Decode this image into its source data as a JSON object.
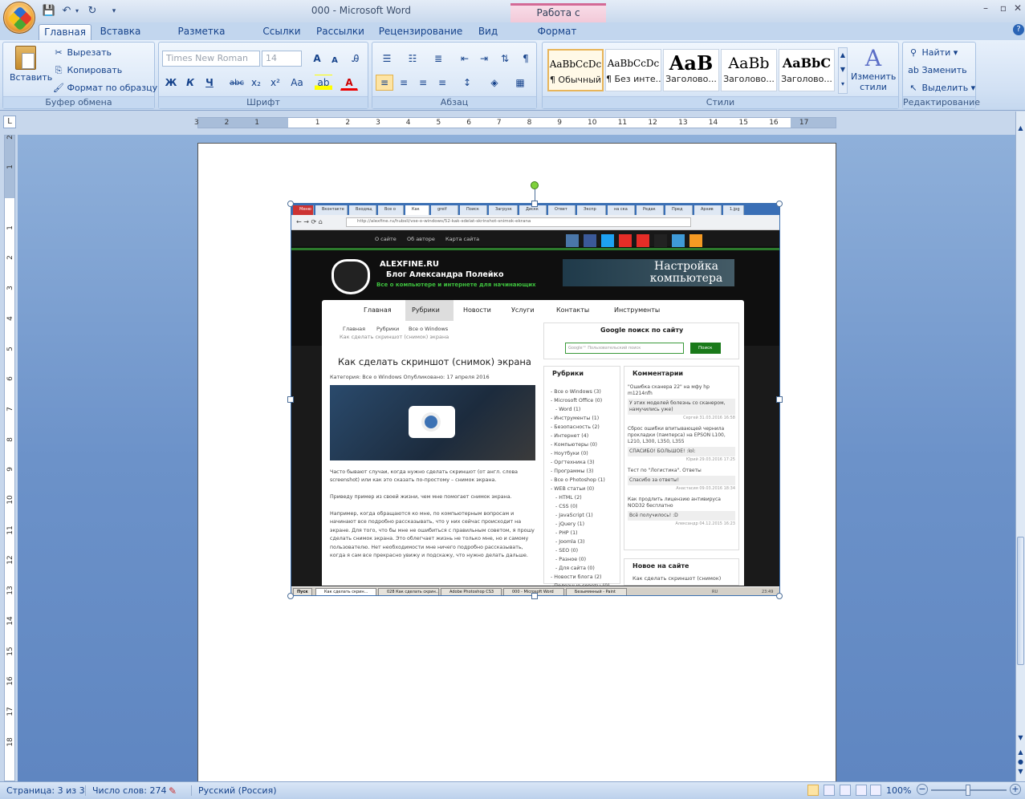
{
  "window": {
    "title": "000 - Microsoft Word",
    "context_tool": "Работа с рисунками"
  },
  "tabs": [
    "Главная",
    "Вставка",
    "Разметка страницы",
    "Ссылки",
    "Рассылки",
    "Рецензирование",
    "Вид",
    "Формат"
  ],
  "ribbon": {
    "clipboard": {
      "paste": "Вставить",
      "cut": "Вырезать",
      "copy": "Копировать",
      "format_painter": "Формат по образцу",
      "label": "Буфер обмена"
    },
    "font": {
      "family": "Times New Roman",
      "size": "14",
      "label": "Шрифт",
      "bold": "Ж",
      "italic": "К",
      "underline": "Ч",
      "strike": "abc",
      "sub": "x₂",
      "sup": "x²",
      "case": "Aa"
    },
    "paragraph": {
      "label": "Абзац"
    },
    "styles": {
      "label": "Стили",
      "items": [
        {
          "sample": "AaBbCcDc",
          "name": "¶ Обычный"
        },
        {
          "sample": "AaBbCcDc",
          "name": "¶ Без инте..."
        },
        {
          "sample": "AaB",
          "name": "Заголово..."
        },
        {
          "sample": "AaBb",
          "name": "Заголово..."
        },
        {
          "sample": "AaBbC",
          "name": "Заголово..."
        }
      ],
      "change": "Изменить стили"
    },
    "editing": {
      "find": "Найти",
      "replace": "Заменить",
      "select": "Выделить",
      "label": "Редактирование"
    }
  },
  "ruler": {
    "h_ticks": [
      "3",
      "2",
      "1",
      "1",
      "2",
      "3",
      "4",
      "5",
      "6",
      "7",
      "8",
      "9",
      "10",
      "11",
      "12",
      "13",
      "14",
      "15",
      "16",
      "17"
    ],
    "v_ticks": [
      "2",
      "1",
      "1",
      "2",
      "3",
      "4",
      "5",
      "6",
      "7",
      "8",
      "9",
      "10",
      "11",
      "12",
      "13",
      "14",
      "15",
      "16",
      "17",
      "18"
    ]
  },
  "screenshot": {
    "url": "http://alexfine.ru/hubsli/vse-o-windows/52-kak-sdelat-skrinshot-snimok-ekrana",
    "top_links": [
      "О сайте",
      "Об авторе",
      "Карта сайта"
    ],
    "site_name": "ALEXFINE.RU",
    "site_owner": "Блог Александра Полейко",
    "site_tagline": "Все о компьютере и интернете для начинающих",
    "banner": "Настройка компьютера",
    "nav": [
      "Главная",
      "Рубрики",
      "Новости",
      "Услуги",
      "Контакты",
      "Инструменты"
    ],
    "breadcrumb": [
      "Главная",
      "Рубрики",
      "Все о Windows",
      "Как сделать скриншот (снимок) экрана"
    ],
    "article_title": "Как сделать скриншот (снимок) экрана",
    "article_meta": "Категория: Все о Windows    Опубликовано: 17 апреля 2016",
    "article_text": [
      "Часто бывают случаи, когда нужно сделать скриншот (от англ. слова",
      "screenshot) или как это сказать по-простому – снимок экрана.",
      "",
      "Приведу пример из своей жизни, чем мне помогает снимок экрана.",
      "",
      "Например, когда обращаются ко мне, по компьютерным вопросам и",
      "начинают все подробно рассказывать, что у них сейчас происходит на",
      "экране. Для того, что бы мне не ошибиться с правильным советом, я прошу",
      "сделать снимок экрана. Это облегчает жизнь не только мне, но и самому",
      "пользователю. Нет необходимости мне ничего подробно рассказывать,",
      "когда я сам все прекрасно увижу и подскажу, что нужно делать дальше."
    ],
    "google_title": "Google поиск по сайту",
    "google_placeholder": "Google™ Пользовательский поиск",
    "google_btn": "Поиск",
    "rubrics_title": "Рубрики",
    "rubrics": [
      "- Все о Windows (3)",
      "- Microsoft Office (0)",
      "   - Word (1)",
      "- Инструменты (1)",
      "- Безопасность (2)",
      "- Интернет (4)",
      "- Компьютеры (0)",
      "- Ноутбуки (0)",
      "- Оргтехника (3)",
      "- Программы (3)",
      "- Все о Photoshop (1)",
      "- WEB статьи (0)",
      "   - HTML (2)",
      "   - CSS (0)",
      "   - JavaScript (1)",
      "   - jQuery (1)",
      "   - PHP (1)",
      "   - Joomla (3)",
      "   - SEO (0)",
      "   - Разное (0)",
      "   - Для сайта (0)",
      "- Новости блога (2)",
      "- Полезные советы (0)"
    ],
    "comments_title": "Комментарии",
    "comments": [
      {
        "topic": "\"Ошибка сканера 22\" на мфу hp m1214nfh",
        "text": "У этих моделей болезнь со сканером, намучились уже)",
        "by": "Сергей  31.03.2016 16:58"
      },
      {
        "topic": "Сброс ошибки впитывающей чернила прокладки (памперса) на EPSON L100, L210, L300, L350, L355",
        "text": "СПАСИБО! БОЛЬШОЕ! :lol:",
        "by": "Юрий  29.03.2016 17:25"
      },
      {
        "topic": "Тест по \"Логистика\". Ответы",
        "text": "Спасибо за ответы!",
        "by": "Анастасия  09.03.2016 18:34"
      },
      {
        "topic": "Как продлить лицензию антивируса NOD32 бесплатно",
        "text": "Всё получилось! :D",
        "by": "Александр  04.12.2015 16:23"
      }
    ],
    "new_title": "Новое на сайте",
    "new_first": "Как сделать скриншот (снимок)",
    "taskbar": [
      "Пуск",
      "Как сделать скрин...",
      "028 Как сделать скрин...",
      "Adobe Photoshop CS3",
      "000 - Microsoft Word",
      "Безымянный - Paint"
    ],
    "clock": "23:49",
    "lang": "RU"
  },
  "status": {
    "page": "Страница: 3 из 3",
    "words": "Число слов: 274",
    "lang": "Русский (Россия)",
    "zoom": "100%"
  }
}
